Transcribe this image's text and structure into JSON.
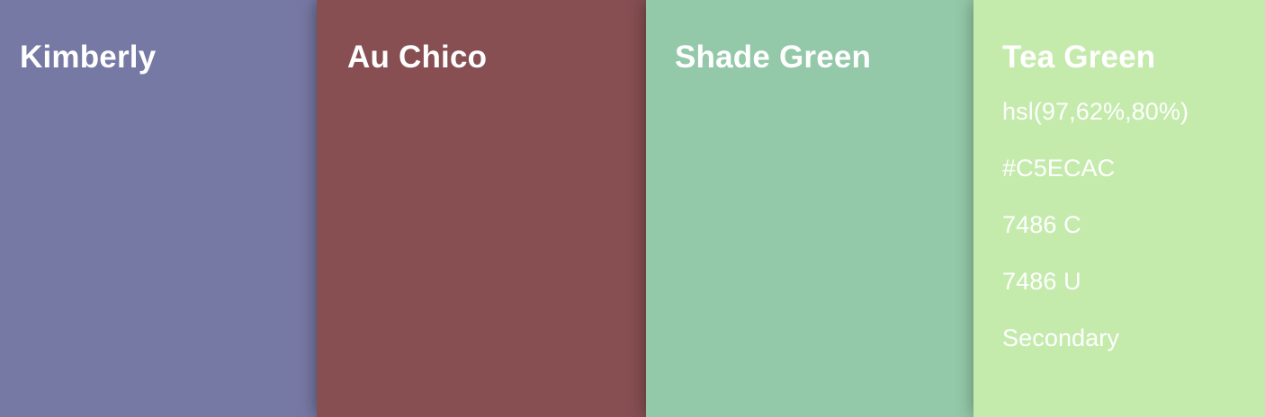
{
  "swatches": [
    {
      "name": "Kimberly",
      "color": "#7779A5",
      "details": []
    },
    {
      "name": "Au Chico",
      "color": "#874F52",
      "details": []
    },
    {
      "name": "Shade Green",
      "color": "#93C8A8",
      "details": []
    },
    {
      "name": "Tea Green",
      "color": "#C5EBAC",
      "details": {
        "hsl": "hsl(97,62%,80%)",
        "hex": "#C5ECAC",
        "pantone_c": "7486 C",
        "pantone_u": "7486 U",
        "role": "Secondary"
      }
    }
  ]
}
